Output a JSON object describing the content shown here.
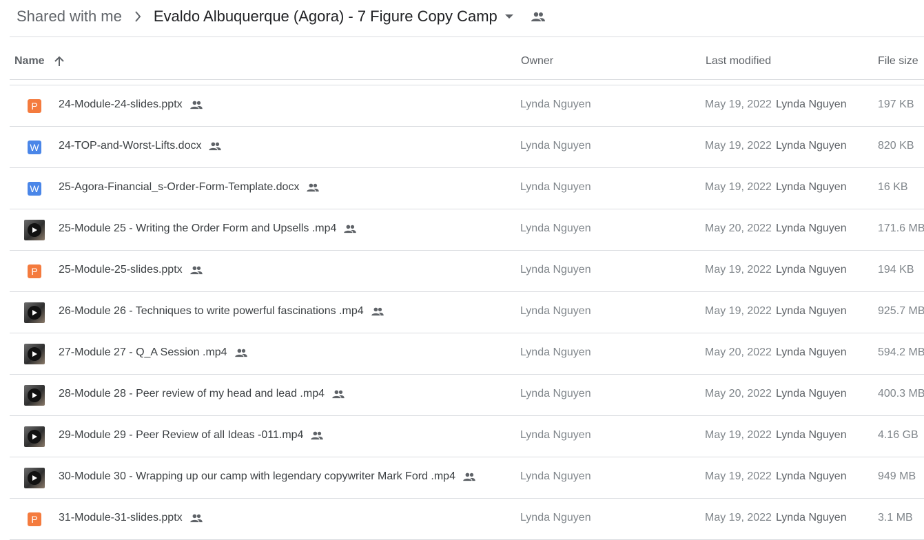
{
  "breadcrumb": {
    "parent": "Shared with me",
    "current": "Evaldo Albuquerque (Agora) - 7 Figure Copy Camp"
  },
  "columns": {
    "name": "Name",
    "owner": "Owner",
    "last_modified": "Last modified",
    "file_size": "File size"
  },
  "colors": {
    "pptx": "#f47b3e",
    "docx": "#4a86e8",
    "divider": "#dadce0"
  },
  "files": [
    {
      "type": "pptx",
      "icon": "P",
      "name": "24-Module-24-slides.pptx",
      "owner": "Lynda Nguyen",
      "modified": "May 19, 2022",
      "modified_by": "Lynda Nguyen",
      "size": "197 KB"
    },
    {
      "type": "docx",
      "icon": "W",
      "name": "24-TOP-and-Worst-Lifts.docx",
      "owner": "Lynda Nguyen",
      "modified": "May 19, 2022",
      "modified_by": "Lynda Nguyen",
      "size": "820 KB"
    },
    {
      "type": "docx",
      "icon": "W",
      "name": "25-Agora-Financial_s-Order-Form-Template.docx",
      "owner": "Lynda Nguyen",
      "modified": "May 19, 2022",
      "modified_by": "Lynda Nguyen",
      "size": "16 KB"
    },
    {
      "type": "video",
      "icon": "",
      "name": "25-Module 25 - Writing the Order Form and Upsells .mp4",
      "owner": "Lynda Nguyen",
      "modified": "May 20, 2022",
      "modified_by": "Lynda Nguyen",
      "size": "171.6 MB"
    },
    {
      "type": "pptx",
      "icon": "P",
      "name": "25-Module-25-slides.pptx",
      "owner": "Lynda Nguyen",
      "modified": "May 19, 2022",
      "modified_by": "Lynda Nguyen",
      "size": "194 KB"
    },
    {
      "type": "video",
      "icon": "",
      "name": "26-Module 26 - Techniques to write powerful fascinations .mp4",
      "owner": "Lynda Nguyen",
      "modified": "May 19, 2022",
      "modified_by": "Lynda Nguyen",
      "size": "925.7 MB"
    },
    {
      "type": "video",
      "icon": "",
      "name": "27-Module 27 - Q_A Session .mp4",
      "owner": "Lynda Nguyen",
      "modified": "May 20, 2022",
      "modified_by": "Lynda Nguyen",
      "size": "594.2 MB"
    },
    {
      "type": "video",
      "icon": "",
      "name": "28-Module 28 - Peer review of my head and lead .mp4",
      "owner": "Lynda Nguyen",
      "modified": "May 20, 2022",
      "modified_by": "Lynda Nguyen",
      "size": "400.3 MB"
    },
    {
      "type": "video",
      "icon": "",
      "name": "29-Module 29 - Peer Review of all Ideas -011.mp4",
      "owner": "Lynda Nguyen",
      "modified": "May 19, 2022",
      "modified_by": "Lynda Nguyen",
      "size": "4.16 GB"
    },
    {
      "type": "video",
      "icon": "",
      "name": "30-Module 30 - Wrapping up our camp with legendary copywriter Mark Ford .mp4",
      "owner": "Lynda Nguyen",
      "modified": "May 19, 2022",
      "modified_by": "Lynda Nguyen",
      "size": "949 MB"
    },
    {
      "type": "pptx",
      "icon": "P",
      "name": "31-Module-31-slides.pptx",
      "owner": "Lynda Nguyen",
      "modified": "May 19, 2022",
      "modified_by": "Lynda Nguyen",
      "size": "3.1 MB"
    }
  ]
}
